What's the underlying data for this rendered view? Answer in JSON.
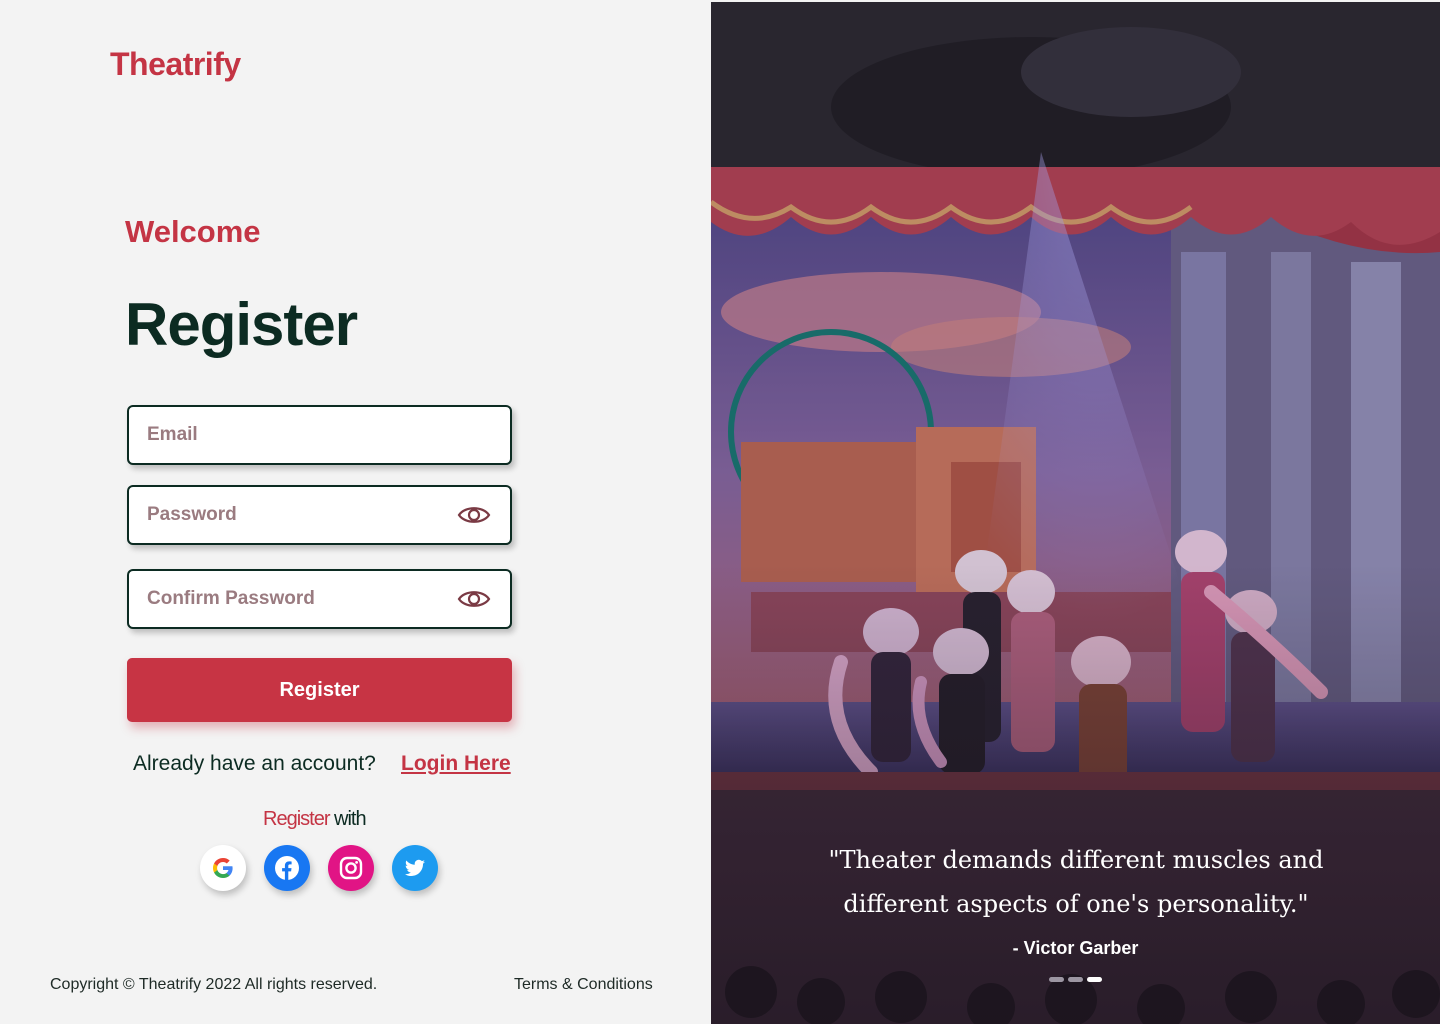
{
  "brand": {
    "name": "Theatrify",
    "accent_color": "#c43444",
    "dark_color": "#0c2b22"
  },
  "form": {
    "welcome": "Welcome",
    "title": "Register",
    "email_placeholder": "Email",
    "password_placeholder": "Password",
    "confirm_placeholder": "Confirm Password",
    "submit_label": "Register",
    "already_text": "Already have an account?",
    "login_link": "Login Here",
    "register_with_accent": "Register",
    "register_with_rest": " with"
  },
  "social": [
    "google-icon",
    "facebook-icon",
    "instagram-icon",
    "twitter-icon"
  ],
  "footer": {
    "copyright": "Copyright © Theatrify 2022 All rights reserved.",
    "terms": "Terms & Conditions"
  },
  "hero": {
    "quote": "\"Theater demands different muscles and different aspects of one's personality.\"",
    "author": "- Victor Garber",
    "carousel_total": 3,
    "carousel_active": 3
  }
}
